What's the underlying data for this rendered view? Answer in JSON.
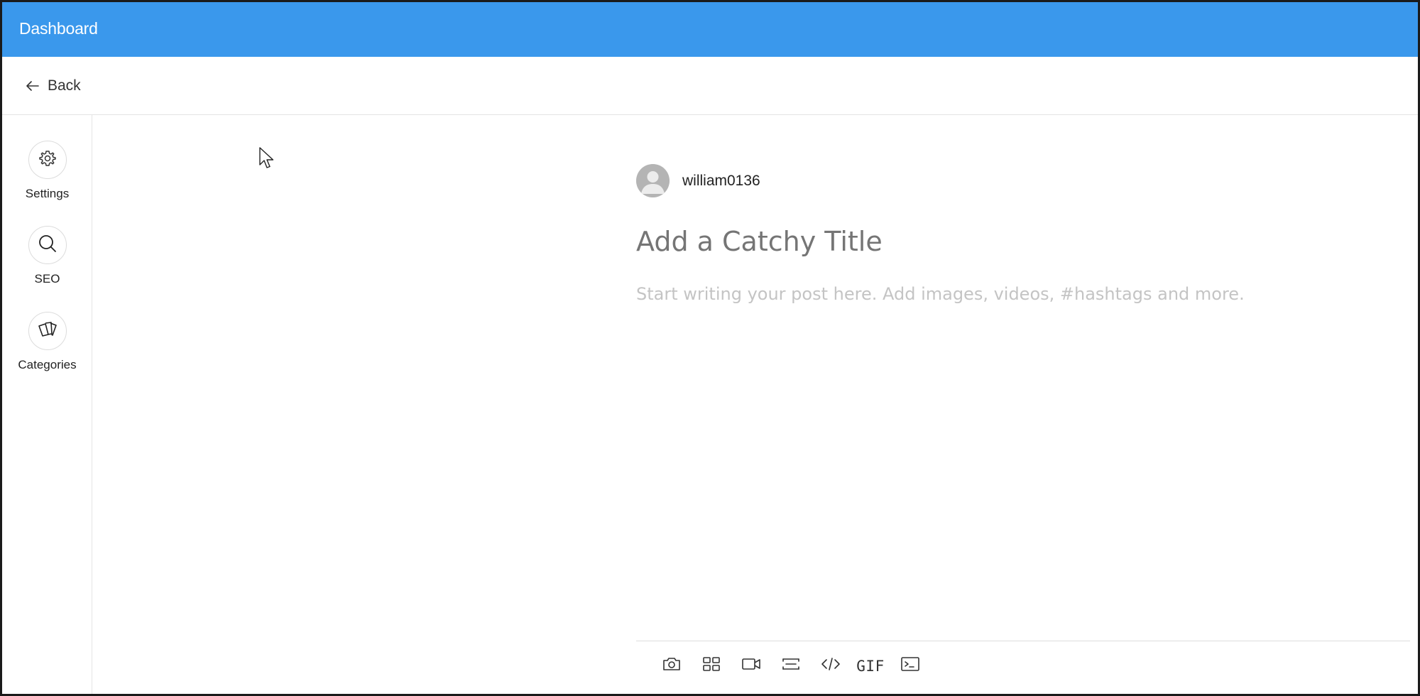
{
  "header": {
    "title": "Dashboard"
  },
  "nav": {
    "back_label": "Back",
    "back_icon": "arrow-left-icon"
  },
  "sidebar": {
    "items": [
      {
        "label": "Settings",
        "icon": "gear-icon"
      },
      {
        "label": "SEO",
        "icon": "search-icon"
      },
      {
        "label": "Categories",
        "icon": "cards-icon"
      }
    ]
  },
  "editor": {
    "author_name": "william0136",
    "title_placeholder": "Add a Catchy Title",
    "body_placeholder": "Start writing your post here. Add images, videos, #hashtags and more."
  },
  "toolbar": {
    "items": [
      {
        "icon": "camera-icon"
      },
      {
        "icon": "gallery-icon"
      },
      {
        "icon": "video-icon"
      },
      {
        "icon": "divider-icon"
      },
      {
        "icon": "code-icon"
      },
      {
        "icon": "gif-icon",
        "label": "GIF"
      },
      {
        "icon": "code-block-icon"
      }
    ]
  },
  "colors": {
    "header_bg": "#3a98ec",
    "placeholder_title": "#9b9b9b",
    "placeholder_body": "#c4c4c4"
  }
}
